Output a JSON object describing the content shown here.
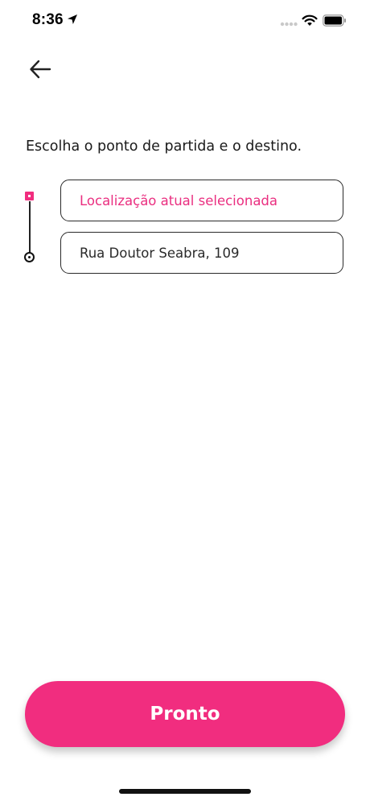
{
  "status_bar": {
    "time": "8:36",
    "icons": [
      "location-arrow-icon",
      "signal-icon",
      "wifi-icon",
      "battery-icon"
    ]
  },
  "header": {
    "back_icon": "arrow-left-icon"
  },
  "main": {
    "instruction": "Escolha o ponto de partida e o destino.",
    "origin_field": {
      "value": "Localização atual selecionada"
    },
    "destination_field": {
      "value": "Rua Doutor Seabra, 109"
    }
  },
  "footer": {
    "done_label": "Pronto"
  },
  "colors": {
    "accent": "#f12d7f",
    "text": "#1a1a1a",
    "border": "#2a2a2a",
    "background": "#ffffff"
  }
}
